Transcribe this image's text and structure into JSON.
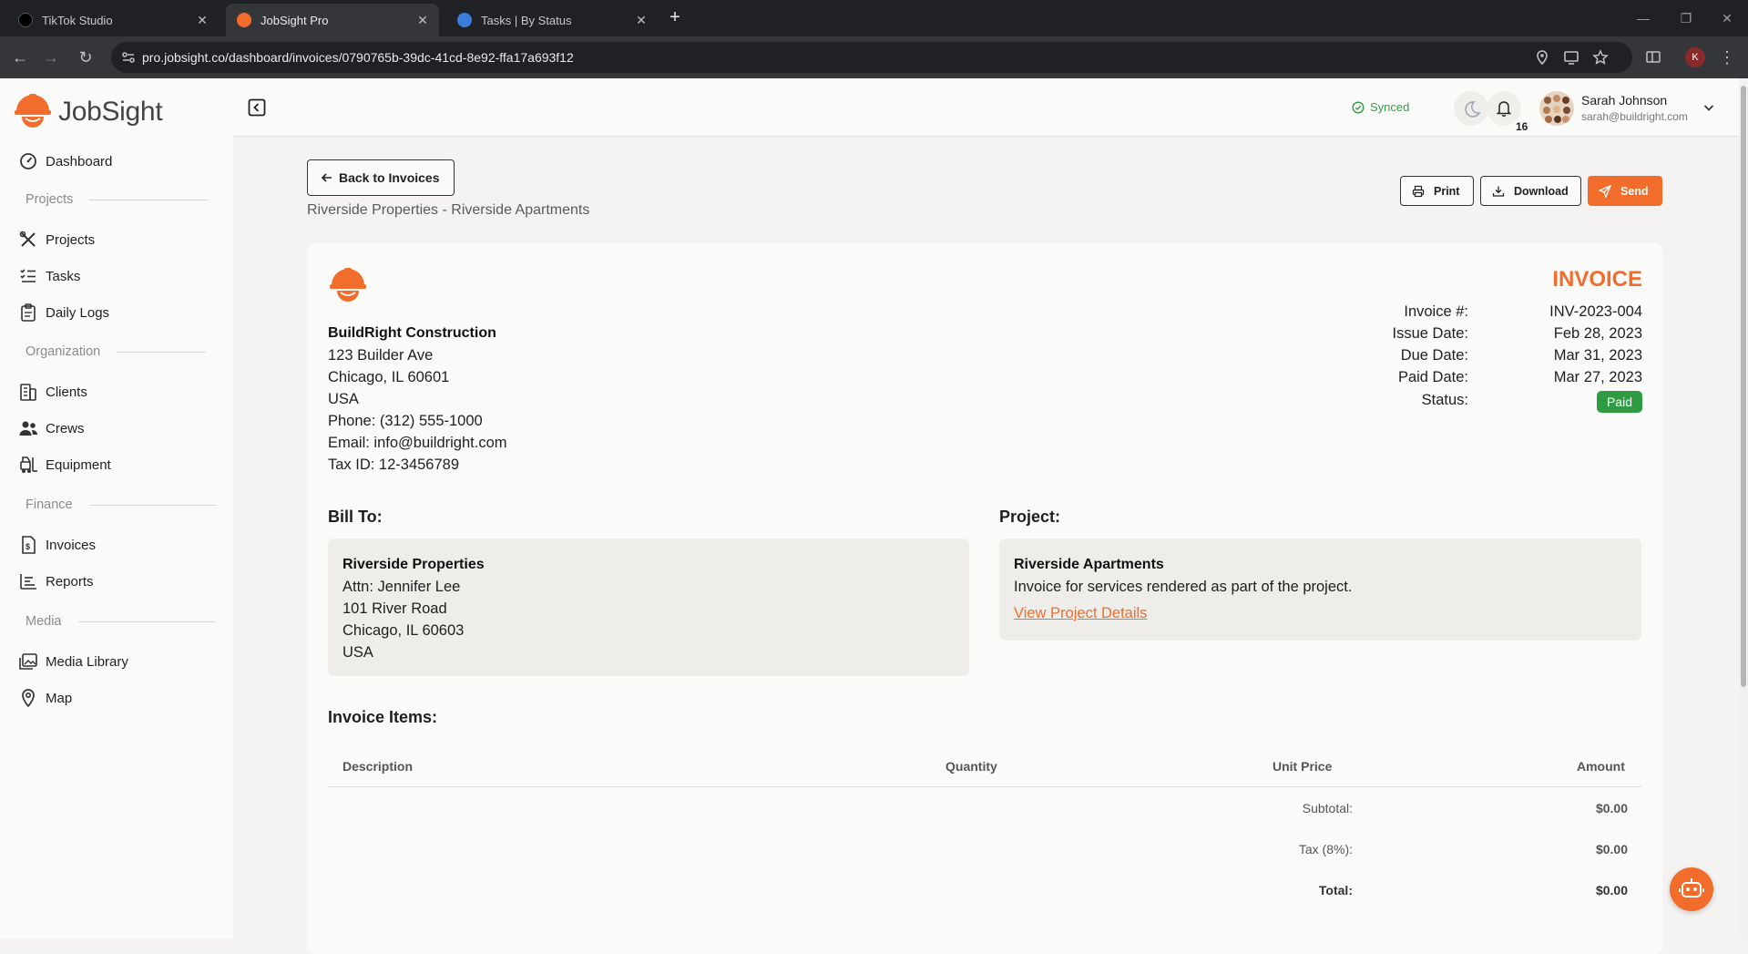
{
  "browser": {
    "tabs": [
      {
        "title": "TikTok Studio",
        "active": false
      },
      {
        "title": "JobSight Pro",
        "active": true
      },
      {
        "title": "Tasks | By Status",
        "active": false
      }
    ],
    "url": "pro.jobsight.co/dashboard/invoices/0790765b-39dc-41cd-8e92-ffa17a693f12",
    "profile_initial": "K"
  },
  "app": {
    "brand": "JobSight",
    "accent_color": "#f26d2b"
  },
  "sidebar": {
    "dashboard": "Dashboard",
    "sections": {
      "projects": "Projects",
      "organization": "Organization",
      "finance": "Finance",
      "media": "Media"
    },
    "items": {
      "projects": "Projects",
      "tasks": "Tasks",
      "daily_logs": "Daily Logs",
      "clients": "Clients",
      "crews": "Crews",
      "equipment": "Equipment",
      "invoices": "Invoices",
      "reports": "Reports",
      "media_library": "Media Library",
      "map": "Map"
    }
  },
  "header": {
    "sync_status": "Synced",
    "notification_count": "16",
    "user_name": "Sarah Johnson",
    "user_email": "sarah@buildright.com"
  },
  "toolbar": {
    "back_label": "Back to Invoices",
    "subtitle": "Riverside Properties - Riverside Apartments",
    "print_label": "Print",
    "download_label": "Download",
    "send_label": "Send"
  },
  "invoice": {
    "title": "INVOICE",
    "company": {
      "name": "BuildRight Construction",
      "address1": "123 Builder Ave",
      "address2": "Chicago, IL 60601",
      "country": "USA",
      "phone": "Phone: (312) 555-1000",
      "email": "Email: info@buildright.com",
      "tax_id": "Tax ID: 12-3456789"
    },
    "meta": {
      "number_label": "Invoice #:",
      "number": "INV-2023-004",
      "issue_label": "Issue Date:",
      "issue_date": "Feb 28, 2023",
      "due_label": "Due Date:",
      "due_date": "Mar 31, 2023",
      "paid_label": "Paid Date:",
      "paid_date": "Mar 27, 2023",
      "status_label": "Status:",
      "status": "Paid",
      "status_color": "#2f9c43"
    },
    "bill_to": {
      "heading": "Bill To:",
      "name": "Riverside Properties",
      "attn": "Attn: Jennifer Lee",
      "address1": "101 River Road",
      "address2": "Chicago, IL 60603",
      "country": "USA"
    },
    "project": {
      "heading": "Project:",
      "name": "Riverside Apartments",
      "description": "Invoice for services rendered as part of the project.",
      "link": "View Project Details"
    },
    "items": {
      "heading": "Invoice Items:",
      "columns": [
        "Description",
        "Quantity",
        "Unit Price",
        "Amount"
      ],
      "rows": []
    },
    "totals": {
      "subtotal_label": "Subtotal:",
      "subtotal": "$0.00",
      "tax_label": "Tax (8%):",
      "tax": "$0.00",
      "total_label": "Total:",
      "total": "$0.00"
    }
  }
}
